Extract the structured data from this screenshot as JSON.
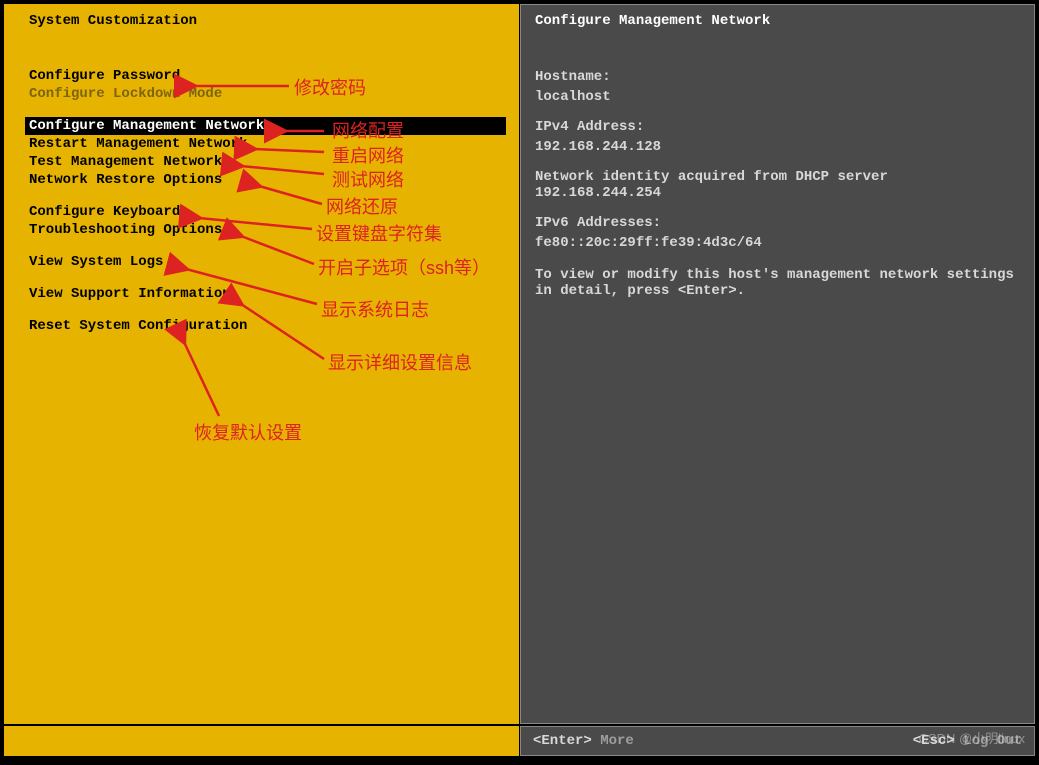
{
  "left": {
    "title": "System Customization",
    "items": [
      "Configure Password",
      "Configure Lockdown Mode",
      "Configure Management Network",
      "Restart Management Network",
      "Test Management Network",
      "Network Restore Options",
      "Configure Keyboard",
      "Troubleshooting Options",
      "View System Logs",
      "View Support Information",
      "Reset System Configuration"
    ]
  },
  "right": {
    "title": "Configure Management Network",
    "hostname_label": "Hostname:",
    "hostname_value": "localhost",
    "ipv4_label": "IPv4 Address:",
    "ipv4_value": "192.168.244.128",
    "dhcp_line": "Network identity acquired from DHCP server 192.168.244.254",
    "ipv6_label": "IPv6 Addresses:",
    "ipv6_value": "fe80::20c:29ff:fe39:4d3c/64",
    "help_text": "To view or modify this host's management network settings in detail, press <Enter>."
  },
  "footer": {
    "enter": "<Enter>",
    "more": "More",
    "esc": "<Esc>",
    "logout": "Log Out"
  },
  "annotations": {
    "a0": "修改密码",
    "a1": "网络配置",
    "a2": "重启网络",
    "a3": "测试网络",
    "a4": "网络还原",
    "a5": "设置键盘字符集",
    "a6": "开启子选项（ssh等）",
    "a7": "显示系统日志",
    "a8": "显示详细设置信息",
    "a9": "恢复默认设置"
  },
  "watermark": "CSDN @小明linux"
}
